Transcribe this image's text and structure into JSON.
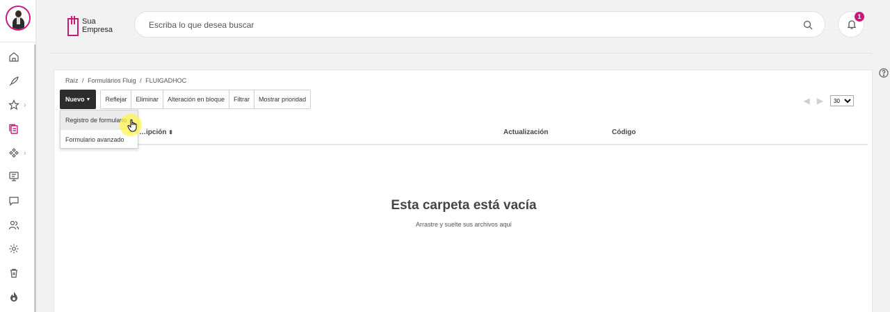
{
  "brand": {
    "logo_line1": "Sua",
    "logo_line2": "Empresa",
    "accent": "#c8187a"
  },
  "search": {
    "placeholder": "Escriba lo que desea buscar"
  },
  "notifications": {
    "count": "1"
  },
  "sidebar": {
    "items": [
      {
        "icon": "home-icon"
      },
      {
        "icon": "rocket-icon"
      },
      {
        "icon": "star-icon",
        "has_submenu": true
      },
      {
        "icon": "documents-icon",
        "active": true
      },
      {
        "icon": "workflow-icon",
        "has_submenu": true
      },
      {
        "icon": "monitor-icon"
      },
      {
        "icon": "chat-icon"
      },
      {
        "icon": "users-icon"
      },
      {
        "icon": "gear-icon"
      },
      {
        "icon": "trash-icon"
      },
      {
        "icon": "flame-icon"
      }
    ]
  },
  "breadcrumb": {
    "root": "Raíz",
    "sep": "/",
    "level1": "Formulários Fluig",
    "level2": "FLUIGADHOC"
  },
  "toolbar": {
    "new_label": "Nuevo",
    "buttons": [
      "Reflejar",
      "Eliminar",
      "Alteración en bloque",
      "Filtrar",
      "Mostrar prioridad"
    ]
  },
  "new_menu": {
    "items": [
      "Registro de formulario",
      "Formulario avanzado"
    ]
  },
  "pager": {
    "page_size": "30"
  },
  "table": {
    "columns": [
      "…ipción",
      "Actualización",
      "Código"
    ]
  },
  "empty_state": {
    "title": "Esta carpeta está vacía",
    "subtitle": "Arrastre y suelte sus archivos aquí"
  }
}
